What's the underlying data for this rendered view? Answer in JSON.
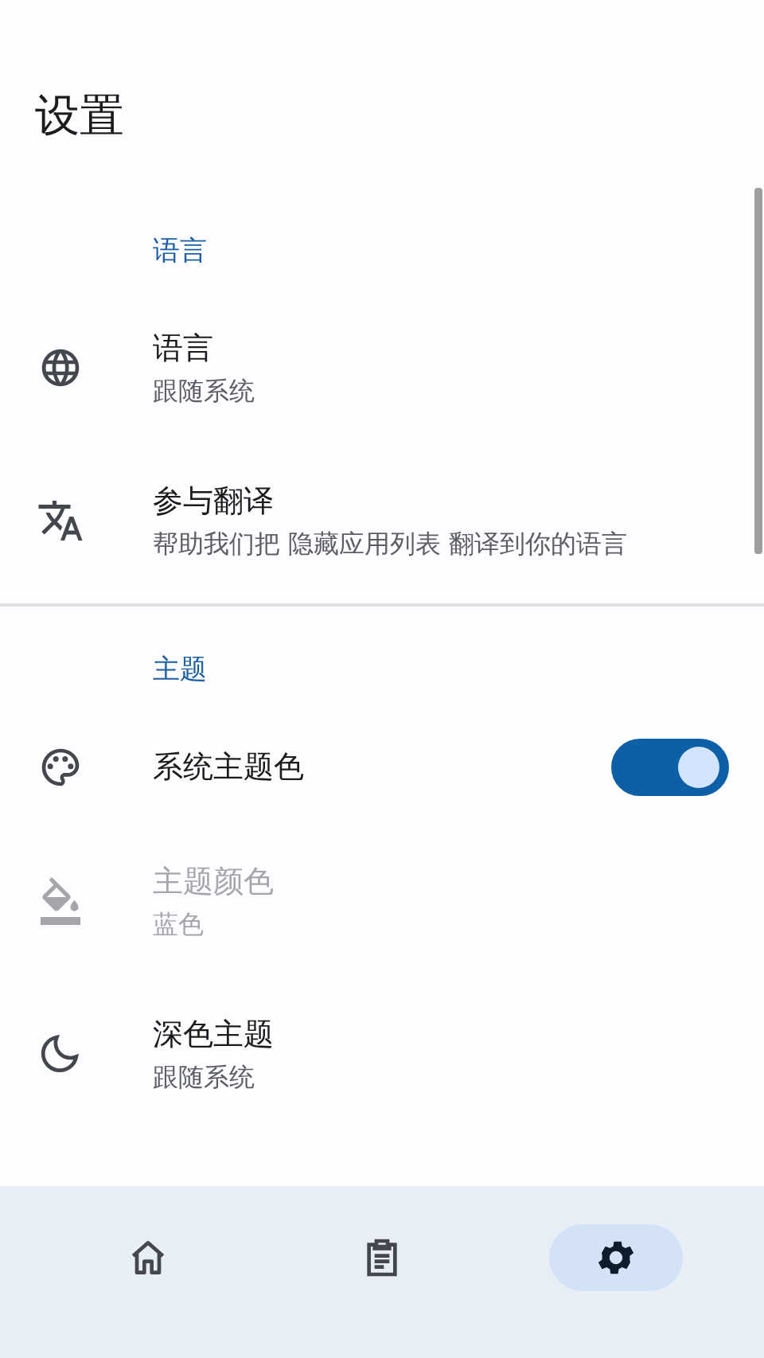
{
  "title": "设置",
  "sections": [
    {
      "header": "语言",
      "items": [
        {
          "kind": "link",
          "title": "语言",
          "subtitle": "跟随系统",
          "disabled": false
        },
        {
          "kind": "link",
          "title": "参与翻译",
          "subtitle": "帮助我们把 隐藏应用列表 翻译到你的语言",
          "disabled": false
        }
      ]
    },
    {
      "header": "主题",
      "items": [
        {
          "kind": "switch",
          "title": "系统主题色",
          "on": true,
          "disabled": false
        },
        {
          "kind": "link",
          "title": "主题颜色",
          "subtitle": "蓝色",
          "disabled": true
        },
        {
          "kind": "link",
          "title": "深色主题",
          "subtitle": "跟随系统",
          "disabled": false
        }
      ]
    }
  ],
  "nav": [
    {
      "selected": false
    },
    {
      "selected": false
    },
    {
      "selected": true
    }
  ]
}
